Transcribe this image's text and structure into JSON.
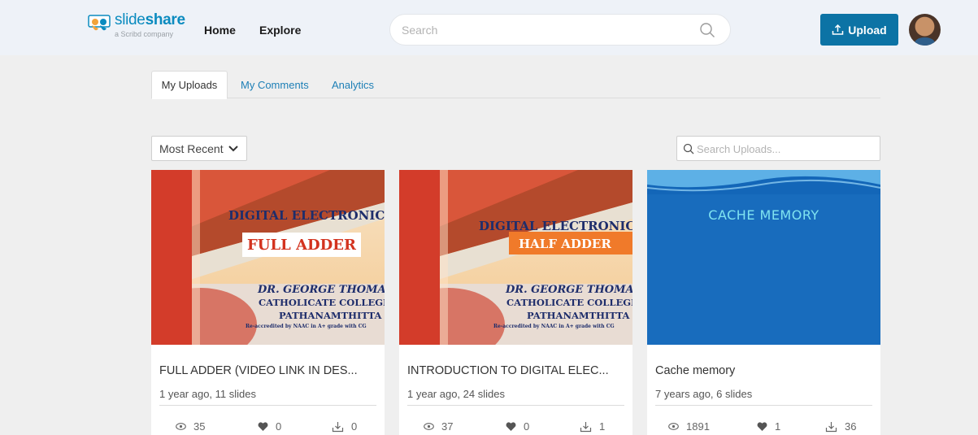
{
  "header": {
    "logo": {
      "word1": "slide",
      "word2": "share",
      "tagline": "a Scribd company"
    },
    "nav": [
      {
        "label": "Home"
      },
      {
        "label": "Explore"
      }
    ],
    "search_placeholder": "Search",
    "upload_label": "Upload",
    "accent_color": "#0c73a5"
  },
  "tabs": [
    {
      "label": "My Uploads",
      "active": true
    },
    {
      "label": "My Comments",
      "active": false
    },
    {
      "label": "Analytics",
      "active": false
    }
  ],
  "sort": {
    "selected": "Most Recent"
  },
  "search_uploads": {
    "placeholder": "Search Uploads..."
  },
  "cards": [
    {
      "title": "FULL ADDER (VIDEO LINK IN DES...",
      "meta": "1 year ago, 11 slides",
      "views": "35",
      "likes": "0",
      "downloads": "0",
      "thumb": {
        "heading": "DIGITAL ELECTRONICS",
        "subheading": "FULL ADDER",
        "author": "DR. GEORGE THOMAS",
        "college": "CATHOLICATE COLLEGE",
        "place": "PATHANAMTHITTA",
        "note": "Re-accredited by NAAC in A+ grade with CG"
      }
    },
    {
      "title": "INTRODUCTION TO DIGITAL ELEC...",
      "meta": "1 year ago, 24 slides",
      "views": "37",
      "likes": "0",
      "downloads": "1",
      "thumb": {
        "heading": "DIGITAL ELECTRONIC",
        "subheading": "HALF ADDER",
        "author": "DR. GEORGE THOMAS",
        "college": "CATHOLICATE COLLEGE",
        "place": "PATHANAMTHITTA",
        "note": "Re-accredited by NAAC in A+ grade with CG"
      }
    },
    {
      "title": "Cache memory",
      "meta": "7 years ago, 6 slides",
      "views": "1891",
      "likes": "1",
      "downloads": "36",
      "thumb": {
        "heading": "CACHE MEMORY"
      }
    }
  ]
}
